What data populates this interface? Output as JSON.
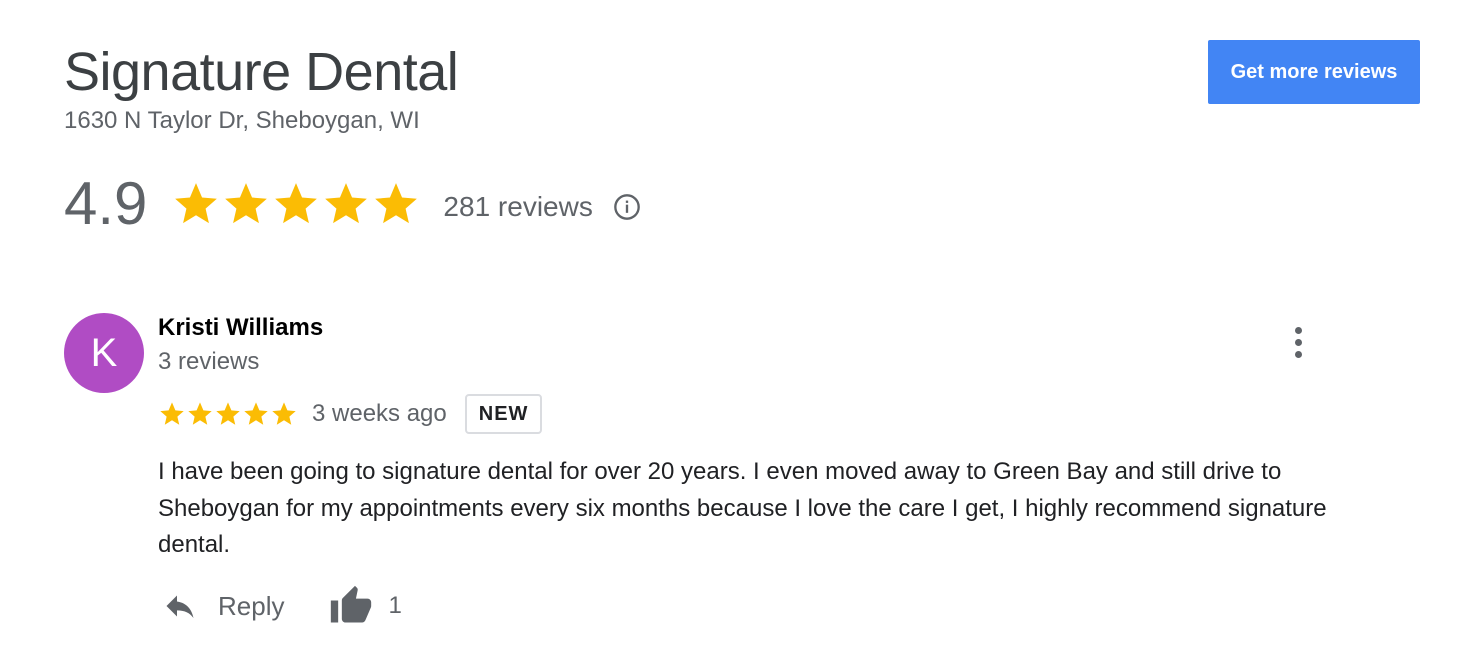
{
  "business": {
    "name": "Signature Dental",
    "address": "1630 N Taylor Dr, Sheboygan, WI"
  },
  "cta": {
    "label": "Get more reviews"
  },
  "rating": {
    "value": "4.9",
    "stars": 5,
    "count_text": "281 reviews"
  },
  "colors": {
    "accent": "#4285f4",
    "star": "#fbbc04",
    "avatar": "#b04cc4"
  },
  "icons": [
    "info-icon",
    "star-icon",
    "more-vert-icon",
    "reply-icon",
    "thumbs-up-icon"
  ],
  "review": {
    "avatar_letter": "K",
    "author": "Kristi Williams",
    "author_reviews": "3 reviews",
    "stars": 5,
    "time": "3 weeks ago",
    "badge": "NEW",
    "text": "I have been going to signature dental for over 20 years. I even moved away to Green Bay and still drive to Sheboygan for my appointments every six months because I love the care I get, I highly recommend signature dental.",
    "reply_label": "Reply",
    "likes": "1"
  }
}
